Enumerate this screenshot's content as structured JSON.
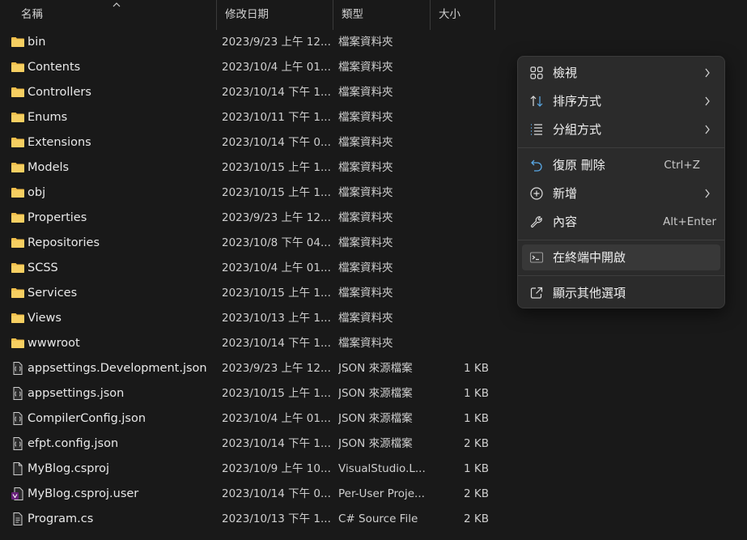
{
  "header": {
    "name": "名稱",
    "date": "修改日期",
    "type": "類型",
    "size": "大小"
  },
  "rows": [
    {
      "name": "bin",
      "date": "2023/9/23 上午 12...",
      "type": "檔案資料夾",
      "size": "",
      "icon": "folder-icon"
    },
    {
      "name": "Contents",
      "date": "2023/10/4 上午 01...",
      "type": "檔案資料夾",
      "size": "",
      "icon": "folder-icon"
    },
    {
      "name": "Controllers",
      "date": "2023/10/14 下午 1...",
      "type": "檔案資料夾",
      "size": "",
      "icon": "folder-icon"
    },
    {
      "name": "Enums",
      "date": "2023/10/11 下午 1...",
      "type": "檔案資料夾",
      "size": "",
      "icon": "folder-icon"
    },
    {
      "name": "Extensions",
      "date": "2023/10/14 下午 0...",
      "type": "檔案資料夾",
      "size": "",
      "icon": "folder-icon"
    },
    {
      "name": "Models",
      "date": "2023/10/15 上午 1...",
      "type": "檔案資料夾",
      "size": "",
      "icon": "folder-icon"
    },
    {
      "name": "obj",
      "date": "2023/10/15 上午 1...",
      "type": "檔案資料夾",
      "size": "",
      "icon": "folder-icon"
    },
    {
      "name": "Properties",
      "date": "2023/9/23 上午 12...",
      "type": "檔案資料夾",
      "size": "",
      "icon": "folder-icon"
    },
    {
      "name": "Repositories",
      "date": "2023/10/8 下午 04...",
      "type": "檔案資料夾",
      "size": "",
      "icon": "folder-icon"
    },
    {
      "name": "SCSS",
      "date": "2023/10/4 上午 01...",
      "type": "檔案資料夾",
      "size": "",
      "icon": "folder-icon"
    },
    {
      "name": "Services",
      "date": "2023/10/15 上午 1...",
      "type": "檔案資料夾",
      "size": "",
      "icon": "folder-icon"
    },
    {
      "name": "Views",
      "date": "2023/10/13 上午 1...",
      "type": "檔案資料夾",
      "size": "",
      "icon": "folder-icon"
    },
    {
      "name": "wwwroot",
      "date": "2023/10/14 下午 1...",
      "type": "檔案資料夾",
      "size": "",
      "icon": "folder-icon"
    },
    {
      "name": "appsettings.Development.json",
      "date": "2023/9/23 上午 12...",
      "type": "JSON 來源檔案",
      "size": "1 KB",
      "icon": "json-file-icon"
    },
    {
      "name": "appsettings.json",
      "date": "2023/10/15 上午 1...",
      "type": "JSON 來源檔案",
      "size": "1 KB",
      "icon": "json-file-icon"
    },
    {
      "name": "CompilerConfig.json",
      "date": "2023/10/4 上午 01...",
      "type": "JSON 來源檔案",
      "size": "1 KB",
      "icon": "json-file-icon"
    },
    {
      "name": "efpt.config.json",
      "date": "2023/10/14 下午 1...",
      "type": "JSON 來源檔案",
      "size": "2 KB",
      "icon": "json-file-icon"
    },
    {
      "name": "MyBlog.csproj",
      "date": "2023/10/9 上午 10...",
      "type": "VisualStudio.L...",
      "size": "1 KB",
      "icon": "file-icon"
    },
    {
      "name": "MyBlog.csproj.user",
      "date": "2023/10/14 下午 0...",
      "type": "Per-User Proje...",
      "size": "2 KB",
      "icon": "user-file-icon"
    },
    {
      "name": "Program.cs",
      "date": "2023/10/13 下午 1...",
      "type": "C# Source File",
      "size": "2 KB",
      "icon": "cs-file-icon"
    }
  ],
  "context_menu": {
    "view": {
      "label": "檢視",
      "icon": "grid-view-icon"
    },
    "sort": {
      "label": "排序方式",
      "icon": "sort-icon"
    },
    "group": {
      "label": "分組方式",
      "icon": "group-list-icon"
    },
    "undo": {
      "label": "復原 刪除",
      "shortcut": "Ctrl+Z",
      "icon": "undo-icon"
    },
    "new": {
      "label": "新增",
      "icon": "add-circle-icon"
    },
    "properties": {
      "label": "內容",
      "shortcut": "Alt+Enter",
      "icon": "wrench-icon"
    },
    "terminal": {
      "label": "在終端中開啟",
      "icon": "terminal-icon"
    },
    "more": {
      "label": "顯示其他選項",
      "icon": "open-external-icon"
    }
  },
  "colors": {
    "background": "#191919",
    "menu_background": "#2b2b2b",
    "folder": "#f2c04c",
    "accent": "#5aa9e6"
  }
}
